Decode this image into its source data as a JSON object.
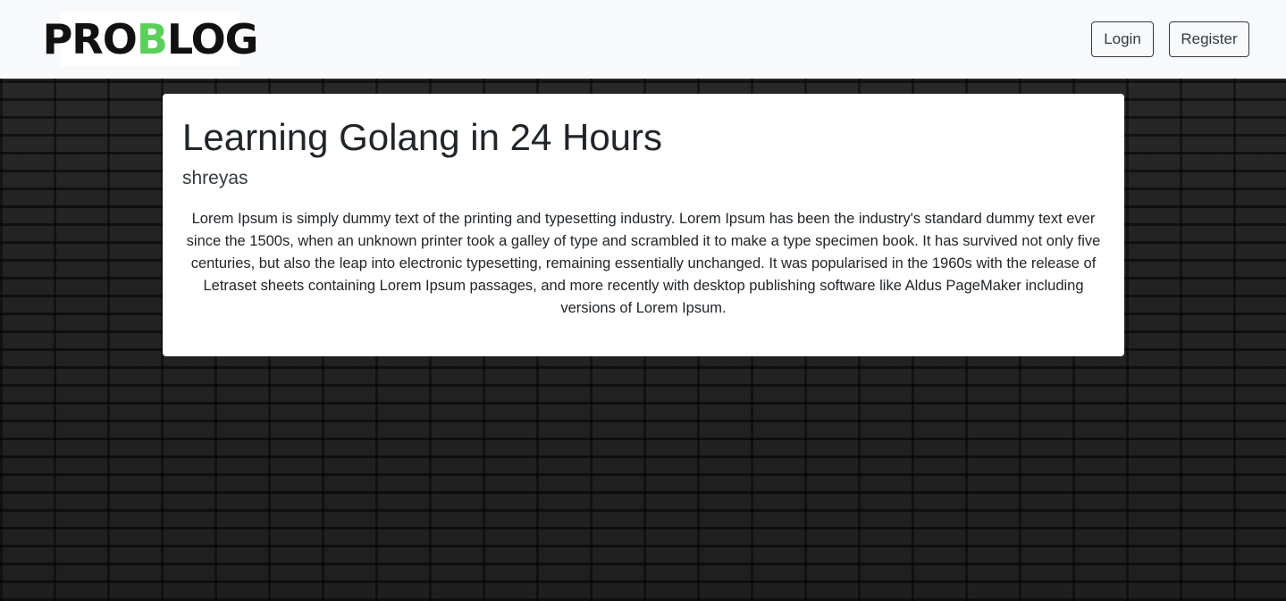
{
  "header": {
    "logo": {
      "text_before": "PRO",
      "text_accent": "B",
      "text_after": "LOG",
      "accent_color": "#5ad05a"
    },
    "login_label": "Login",
    "register_label": "Register"
  },
  "post": {
    "title": "Learning Golang in 24 Hours",
    "author": "shreyas",
    "body": "Lorem Ipsum is simply dummy text of the printing and typesetting industry. Lorem Ipsum has been the industry's standard dummy text ever since the 1500s, when an unknown printer took a galley of type and scrambled it to make a type specimen book. It has survived not only five centuries, but also the leap into electronic typesetting, remaining essentially unchanged. It was popularised in the 1960s with the release of Letraset sheets containing Lorem Ipsum passages, and more recently with desktop publishing software like Aldus PageMaker including versions of Lorem Ipsum."
  },
  "background": {
    "description": "dark-brick-wall"
  }
}
